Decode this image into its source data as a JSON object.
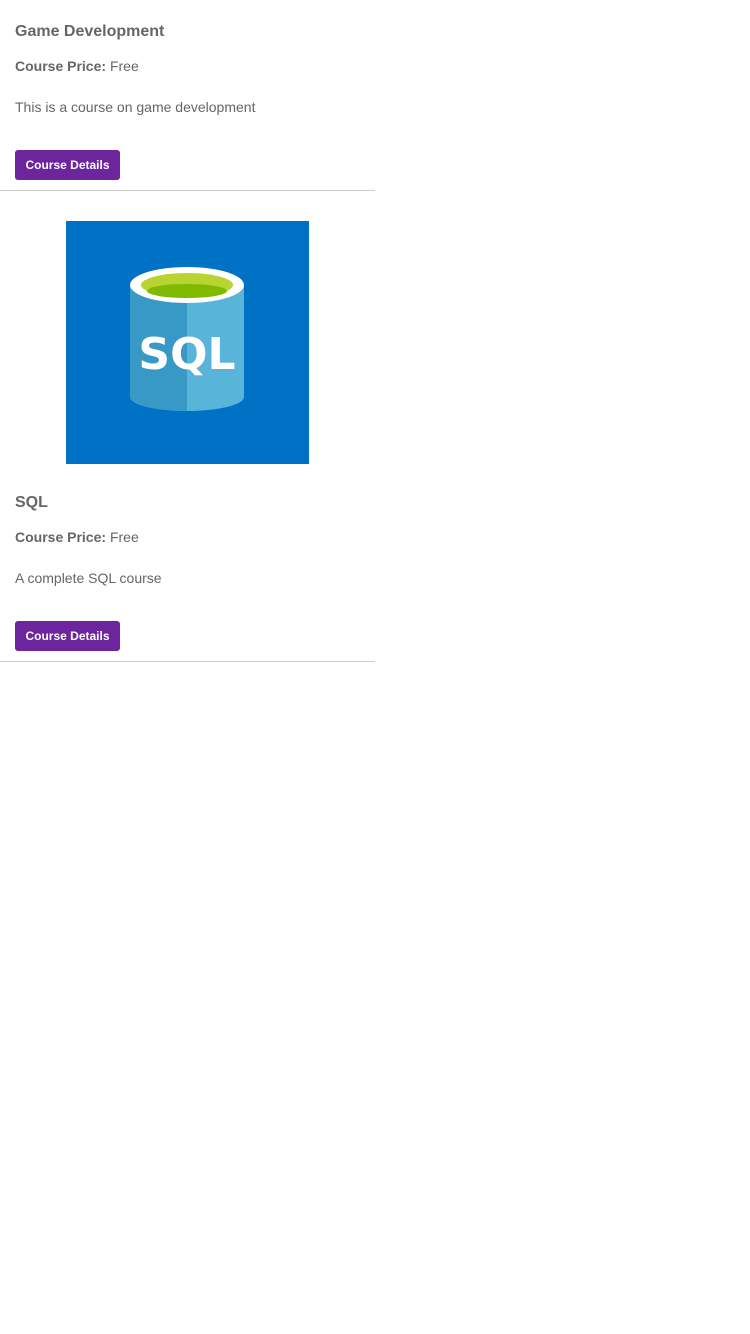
{
  "colors": {
    "button_bg": "#6d259e",
    "button_text": "#ffffff",
    "text": "#666666",
    "divider": "#cccccc",
    "sql_tile_bg": "#0072c6"
  },
  "courses": [
    {
      "title": "Game Development",
      "price_label": "Course Price:",
      "price_value": "Free",
      "description": "This is a course on game development",
      "button_label": "Course Details"
    },
    {
      "image_icon": "sql-database-icon",
      "image_text": "SQL",
      "title": "SQL",
      "price_label": "Course Price:",
      "price_value": "Free",
      "description": "A complete SQL course",
      "button_label": "Course Details"
    }
  ]
}
